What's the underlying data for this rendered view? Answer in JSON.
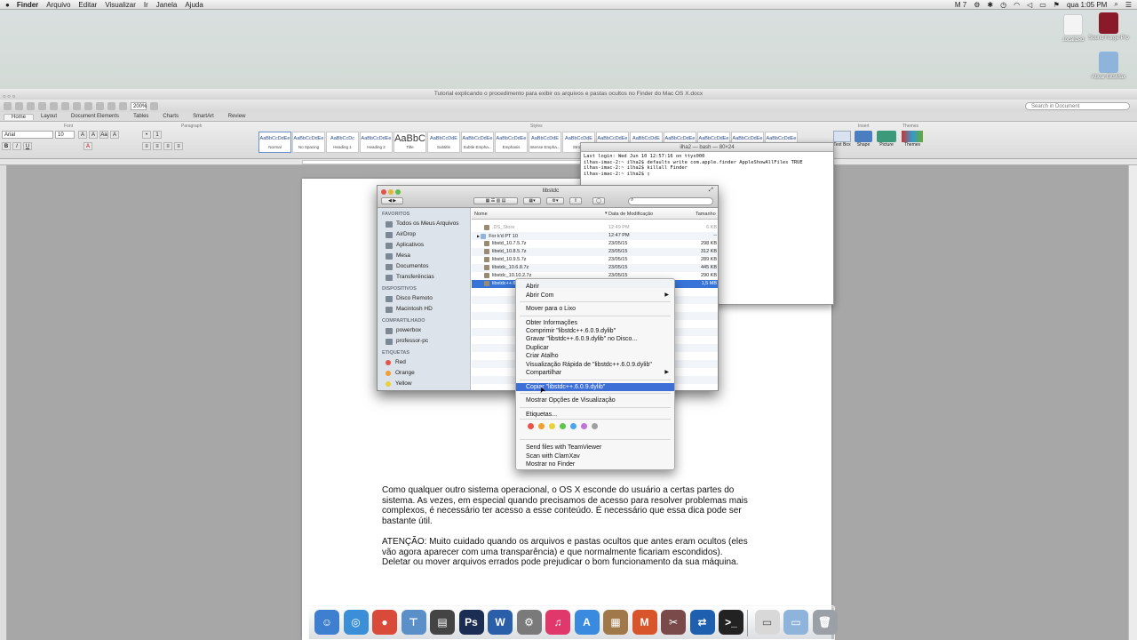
{
  "menubar": {
    "items": [
      "Finder",
      "Arquivo",
      "Editar",
      "Visualizar",
      "Ir",
      "Janela",
      "Ajuda"
    ],
    "status": [
      "M 7",
      "qua 1:05 PM"
    ]
  },
  "desktop": {
    "icons": [
      ".localized",
      "Sound Forge Pro",
      "Ativar BitsMax"
    ]
  },
  "word": {
    "title": "Tutorial explicando o procedimento para exibir os arquivos e pastas ocultos no Finder do Mac OS X.docx",
    "zoom": "200%",
    "search_placeholder": "Search in Document",
    "tabs": [
      "Home",
      "Layout",
      "Document Elements",
      "Tables",
      "Charts",
      "SmartArt",
      "Review"
    ],
    "groups": {
      "font": "Font",
      "paragraph": "Paragraph",
      "styles": "Styles",
      "insert": "Insert",
      "themes": "Themes"
    },
    "font_name": "Arial",
    "font_size": "10",
    "styles": [
      {
        "preview": "AaBbCcDdEe",
        "name": "Normal"
      },
      {
        "preview": "AaBbCcDdEe",
        "name": "No Spacing"
      },
      {
        "preview": "AaBbCcDc",
        "name": "Heading 1"
      },
      {
        "preview": "AaBbCcDdEe",
        "name": "Heading 2"
      },
      {
        "preview": "AaBbC",
        "name": "Title"
      },
      {
        "preview": "AaBbCcDdE",
        "name": "Subtitle"
      },
      {
        "preview": "AaBbCcDdEe",
        "name": "Subtle Empha..."
      },
      {
        "preview": "AaBbCcDdEe",
        "name": "Emphasis"
      },
      {
        "preview": "AaBbCcDdE",
        "name": "Intense Empha..."
      },
      {
        "preview": "AaBbCcDdE",
        "name": "Strong"
      },
      {
        "preview": "AaBbCcDdEe",
        "name": ""
      },
      {
        "preview": "AaBbCcDdE",
        "name": ""
      },
      {
        "preview": "AaBbCcDdEe",
        "name": ""
      },
      {
        "preview": "AaBbCcDdEe",
        "name": ""
      },
      {
        "preview": "AaBbCcDdEe",
        "name": ""
      },
      {
        "preview": "AaBbCcDdEe",
        "name": ""
      }
    ],
    "insert_items": [
      "Text Box",
      "Shape",
      "Picture"
    ],
    "themes_label": "Themes",
    "para1": "Como qualquer outro sistema operacional, o OS X esconde do usuário a certas partes do sistema. As vezes, em especial quando precisamos de acesso para resolver problemas mais complexos, é necessário ter acesso a esse conteúdo. É necessário que essa dica pode ser bastante útil.",
    "para2": "ATENÇÃO: Muito cuidado quando os arquivos e pastas ocultos que antes eram ocultos (eles vão agora aparecer com uma transparência) e que normalmente ficariam escondidos). Deletar ou mover arquivos errados pode prejudicar o bom funcionamento da sua máquina."
  },
  "terminal": {
    "title": "ilha2 — bash — 80×24",
    "lines": [
      "Last login: Wed Jun 10 12:57:16 on ttys000",
      "ilhas-imac-2:~ ilha2$ defaults write com.apple.finder AppleShowAllFiles TRUE",
      "ilhas-imac-2:~ ilha2$ killall Finder",
      "ilhas-imac-2:~ ilha2$ ▯"
    ]
  },
  "finder": {
    "title": "libstdc",
    "search_placeholder": "",
    "sidebar": {
      "favorites_header": "FAVORITOS",
      "favorites": [
        "Todos os Meus Arquivos",
        "AirDrop",
        "Aplicativos",
        "Mesa",
        "Documentos",
        "Transferências"
      ],
      "devices_header": "DISPOSITIVOS",
      "devices": [
        "Disco Remoto",
        "Macintosh HD"
      ],
      "shared_header": "COMPARTILHADO",
      "shared": [
        "powerbox",
        "professor-pc"
      ],
      "tags_header": "ETIQUETAS",
      "tags": [
        {
          "name": "Red",
          "color": "#e5534b"
        },
        {
          "name": "Orange",
          "color": "#f0a030"
        },
        {
          "name": "Yellow",
          "color": "#e8d23a"
        }
      ]
    },
    "columns": [
      "Nome",
      "Data de Modificação",
      "Tamanho"
    ],
    "rows": [
      {
        "name": ".DS_Store",
        "date": "12:49 PM",
        "size": "6 KB",
        "type": "file",
        "dim": true
      },
      {
        "name": "For k'd PT 10",
        "date": "12:47 PM",
        "size": "--",
        "type": "folder",
        "dim": false
      },
      {
        "name": "libstd_10.7.5.7z",
        "date": "23/05/15",
        "size": "298 KB",
        "type": "file",
        "dim": false
      },
      {
        "name": "libstd_10.8.5.7z",
        "date": "23/05/15",
        "size": "312 KB",
        "type": "file",
        "dim": false
      },
      {
        "name": "libstd_10.9.5.7z",
        "date": "23/05/15",
        "size": "289 KB",
        "type": "file",
        "dim": false
      },
      {
        "name": "libstdc_10.6.8.7z",
        "date": "23/05/15",
        "size": "445 KB",
        "type": "file",
        "dim": false
      },
      {
        "name": "libstdc_10.10.2.7z",
        "date": "23/05/15",
        "size": "290 KB",
        "type": "file",
        "dim": false
      },
      {
        "name": "libstdc++.6.0.9.dylib",
        "date": "",
        "size": "1,5 MB",
        "type": "file",
        "dim": false
      }
    ]
  },
  "context_menu": {
    "items": [
      {
        "label": "Abrir",
        "submenu": false
      },
      {
        "label": "Abrir Com",
        "submenu": true
      },
      {
        "label": "Mover para o Lixo",
        "submenu": false
      },
      {
        "label": "Obter Informações",
        "submenu": false
      },
      {
        "label": "Comprimir \"libstdc++.6.0.9.dylib\"",
        "submenu": false
      },
      {
        "label": "Gravar \"libstdc++.6.0.9.dylib\" no Disco...",
        "submenu": false
      },
      {
        "label": "Duplicar",
        "submenu": false
      },
      {
        "label": "Criar Atalho",
        "submenu": false
      },
      {
        "label": "Visualização Rápida de \"libstdc++.6.0.9.dylib\"",
        "submenu": false
      },
      {
        "label": "Compartilhar",
        "submenu": true
      },
      {
        "label": "Copiar \"libstdc++.6.0.9.dylib\"",
        "submenu": false,
        "highlight": true
      },
      {
        "label": "Mostrar Opções de Visualização",
        "submenu": false
      },
      {
        "label": "Etiquetas...",
        "submenu": false
      },
      {
        "label": "Send files with TeamViewer",
        "submenu": false
      },
      {
        "label": "Scan with ClamXav",
        "submenu": false
      },
      {
        "label": "Mostrar no Finder",
        "submenu": false
      }
    ],
    "tag_colors": [
      "#e5534b",
      "#f0a030",
      "#e8d23a",
      "#5ec54a",
      "#4aa6e8",
      "#c074d8",
      "#a0a0a0"
    ]
  },
  "dock": {
    "apps": [
      {
        "name": "finder",
        "glyph": "☺",
        "color": "#3f7fd0"
      },
      {
        "name": "safari",
        "glyph": "◎",
        "color": "#3b8fd8"
      },
      {
        "name": "chrome",
        "glyph": "●",
        "color": "#d94a3a"
      },
      {
        "name": "preview",
        "glyph": "⊤",
        "color": "#5a8fc8"
      },
      {
        "name": "clapper",
        "glyph": "▤",
        "color": "#444444"
      },
      {
        "name": "photoshop",
        "glyph": "Ps",
        "color": "#1b2d52"
      },
      {
        "name": "word",
        "glyph": "W",
        "color": "#2b5ea8"
      },
      {
        "name": "system-preferences",
        "glyph": "⚙",
        "color": "#7a7a7a"
      },
      {
        "name": "itunes",
        "glyph": "♫",
        "color": "#e0386a"
      },
      {
        "name": "app-store",
        "glyph": "A",
        "color": "#3a8be0"
      },
      {
        "name": "archive",
        "glyph": "▦",
        "color": "#a0784a"
      },
      {
        "name": "app-red",
        "glyph": "M",
        "color": "#d8542a"
      },
      {
        "name": "tool",
        "glyph": "✂",
        "color": "#7a4a4a"
      },
      {
        "name": "teamviewer",
        "glyph": "⇄",
        "color": "#1e5fb0"
      },
      {
        "name": "terminal",
        "glyph": ">_",
        "color": "#222222"
      },
      {
        "name": "document",
        "glyph": "▭",
        "color": "#d8d8d8"
      },
      {
        "name": "folder",
        "glyph": "▭",
        "color": "#8fb4dc"
      },
      {
        "name": "trash",
        "glyph": "🗑",
        "color": "#9aa0a6"
      }
    ]
  }
}
